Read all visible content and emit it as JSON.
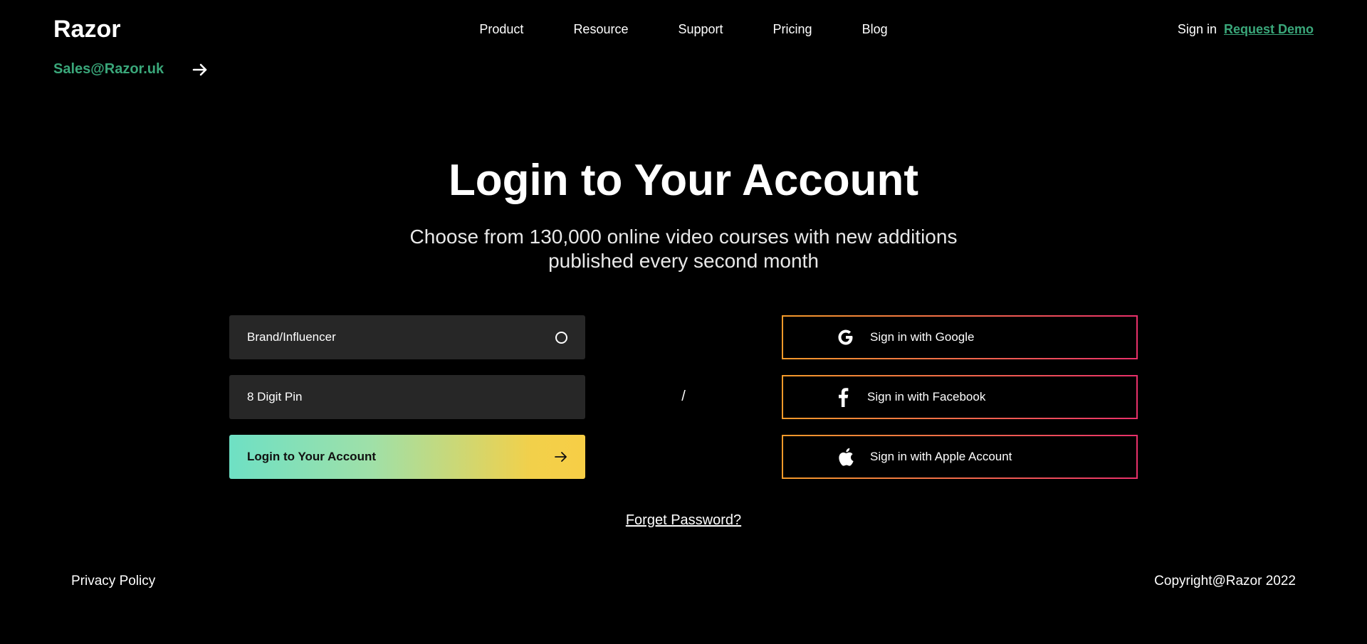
{
  "header": {
    "logo": "Razor",
    "nav": [
      "Product",
      "Resource",
      "Support",
      "Pricing",
      "Blog"
    ],
    "sign_in": "Sign in",
    "request_demo": "Request Demo"
  },
  "sales": {
    "email": "Sales@Razor.uk",
    "arrow_icon": "arrow-right-icon"
  },
  "hero": {
    "title": "Login to Your Account",
    "subtitle_line1": "Choose from 130,000 online video courses with new additions",
    "subtitle_line2": "published every second month"
  },
  "form": {
    "role_field": "Brand/Influencer",
    "role_icon": "radio-icon",
    "pin_field": "8 Digit Pin",
    "login_button": "Login to Your Account",
    "login_icon": "arrow-right-icon"
  },
  "divider": "/",
  "social": [
    {
      "label": "Sign in with Google",
      "icon": "google-icon"
    },
    {
      "label": "Sign in with Facebook",
      "icon": "facebook-icon"
    },
    {
      "label": "Sign in with Apple Account",
      "icon": "apple-icon"
    }
  ],
  "forgot_password": "Forget Password?",
  "footer": {
    "privacy": "Privacy Policy",
    "copyright": "Copyright@Razor 2022"
  },
  "colors": {
    "background": "#000000",
    "accent_green": "#3aa77a",
    "field_bg": "#272727",
    "gradient_start": "#6ee0c4",
    "gradient_end": "#f7ce46",
    "border_orange": "#f39a2a",
    "border_pink": "#e8306a"
  }
}
